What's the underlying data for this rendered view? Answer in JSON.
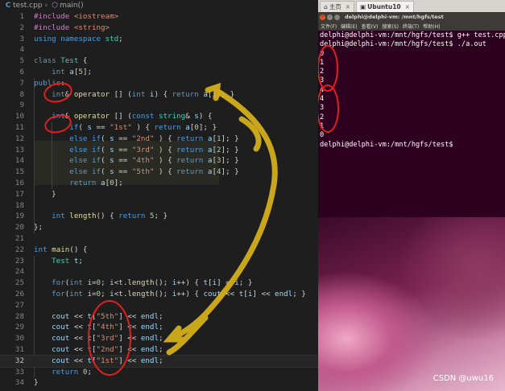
{
  "breadcrumb": {
    "file": "test.cpp",
    "symbol": "main()",
    "file_icon": "cpp-icon",
    "symbol_icon": "cube-icon"
  },
  "editor": {
    "current_line": 32,
    "lines": [
      {
        "n": "1",
        "code": "#include <iostream>"
      },
      {
        "n": "2",
        "code": "#include <string>"
      },
      {
        "n": "3",
        "code": "using namespace std;"
      },
      {
        "n": "4",
        "code": ""
      },
      {
        "n": "5",
        "code": "class Test {"
      },
      {
        "n": "6",
        "code": "    int a[5];"
      },
      {
        "n": "7",
        "code": "public:"
      },
      {
        "n": "8",
        "code": "    int& operator [] (int i) { return a[i]; }"
      },
      {
        "n": "9",
        "code": ""
      },
      {
        "n": "10",
        "code": "    int& operator [] (const string& s) {"
      },
      {
        "n": "11",
        "code": "        if( s == \"1st\" ) { return a[0]; }"
      },
      {
        "n": "12",
        "code": "        else if( s == \"2nd\" ) { return a[1]; }"
      },
      {
        "n": "13",
        "code": "        else if( s == \"3rd\" ) { return a[2]; }"
      },
      {
        "n": "14",
        "code": "        else if( s == \"4th\" ) { return a[3]; }"
      },
      {
        "n": "15",
        "code": "        else if( s == \"5th\" ) { return a[4]; }"
      },
      {
        "n": "16",
        "code": "        return a[0];"
      },
      {
        "n": "17",
        "code": "    }"
      },
      {
        "n": "18",
        "code": ""
      },
      {
        "n": "19",
        "code": "    int length() { return 5; }"
      },
      {
        "n": "20",
        "code": "};"
      },
      {
        "n": "21",
        "code": ""
      },
      {
        "n": "22",
        "code": "int main() {"
      },
      {
        "n": "23",
        "code": "    Test t;"
      },
      {
        "n": "24",
        "code": ""
      },
      {
        "n": "25",
        "code": "    for(int i=0; i<t.length(); i++) { t[i] = i; }"
      },
      {
        "n": "26",
        "code": "    for(int i=0; i<t.length(); i++) { cout << t[i] << endl; }"
      },
      {
        "n": "27",
        "code": ""
      },
      {
        "n": "28",
        "code": "    cout << t[\"5th\"] << endl;"
      },
      {
        "n": "29",
        "code": "    cout << t[\"4th\"] << endl;"
      },
      {
        "n": "30",
        "code": "    cout << t[\"3rd\"] << endl;"
      },
      {
        "n": "31",
        "code": "    cout << t[\"2nd\"] << endl;"
      },
      {
        "n": "32",
        "code": "    cout << t[\"1st\"] << endl;"
      },
      {
        "n": "33",
        "code": "    return 0;"
      },
      {
        "n": "34",
        "code": "}"
      }
    ]
  },
  "vm": {
    "tabs": [
      {
        "label": "主页",
        "icon": "home-icon",
        "active": false
      },
      {
        "label": "Ubuntu10",
        "icon": "vm-icon",
        "active": true
      }
    ],
    "window_title": "delphi@delphi-vm: /mnt/hgfs/test",
    "menu": [
      "文件(F)",
      "编辑(E)",
      "查看(V)",
      "搜索(S)",
      "终端(T)",
      "帮助(H)"
    ],
    "terminal_lines": [
      "delphi@delphi-vm:/mnt/hgfs/test$ g++ test.cpp",
      "delphi@delphi-vm:/mnt/hgfs/test$ ./a.out",
      "0",
      "1",
      "2",
      "3",
      "4",
      "4",
      "3",
      "2",
      "1",
      "0",
      "delphi@delphi-vm:/mnt/hgfs/test$"
    ]
  },
  "watermark": "CSDN @uwu16",
  "colors": {
    "editor_bg": "#1e1e1e",
    "terminal_bg": "#2c001e",
    "annotation_red": "#e02020",
    "annotation_yellow": "#d9b21a"
  }
}
